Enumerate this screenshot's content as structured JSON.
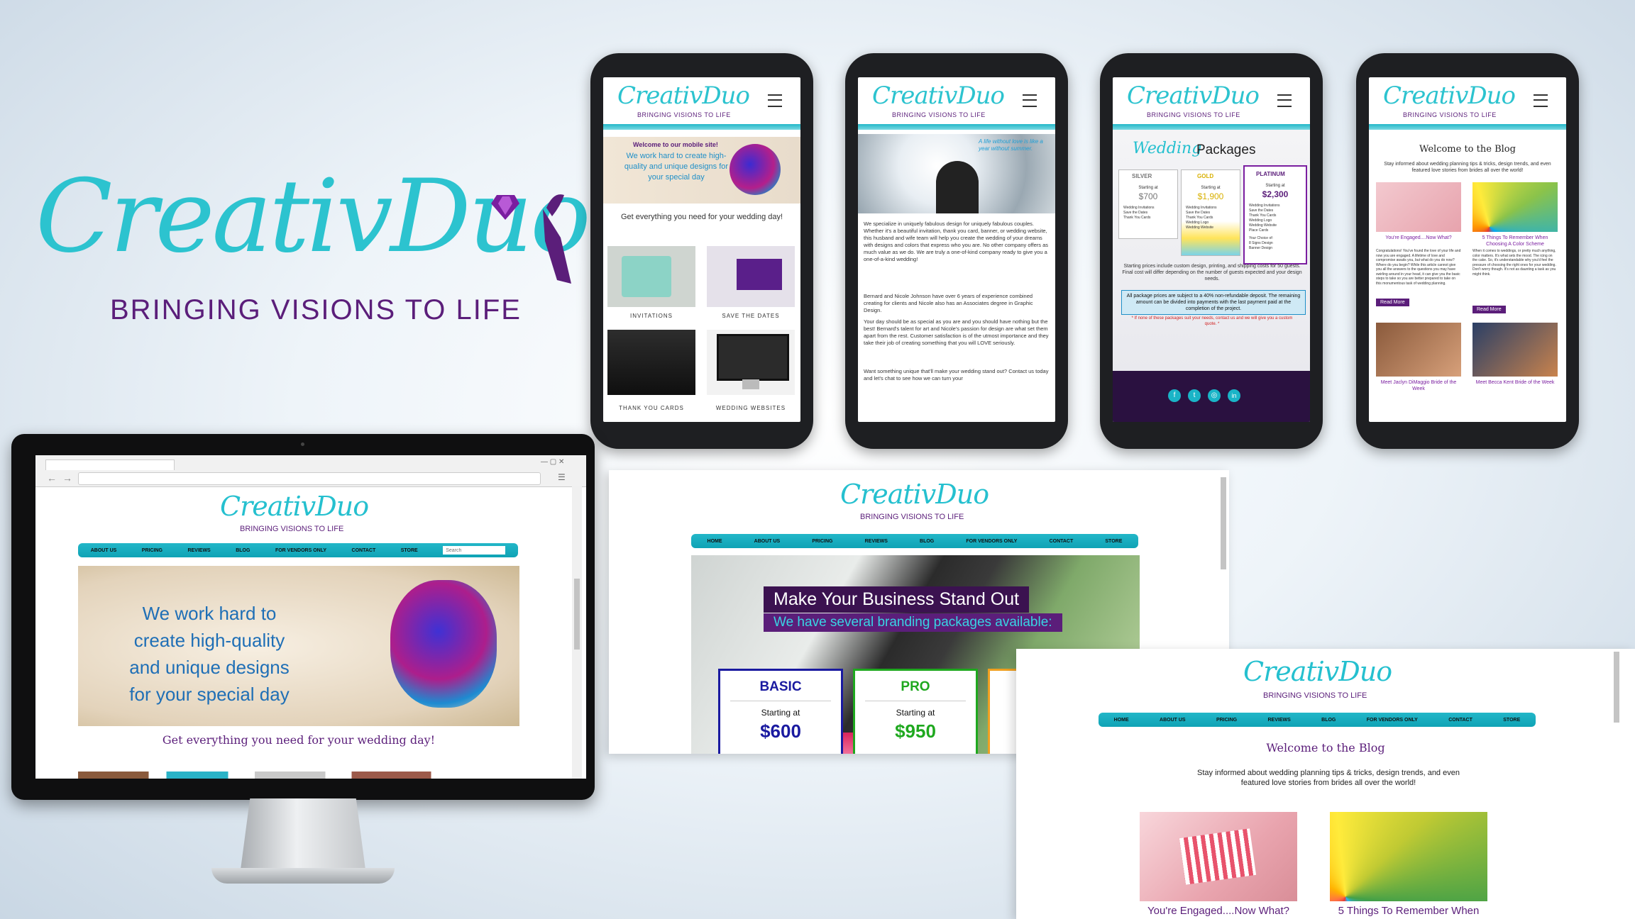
{
  "brand": {
    "name": "CreativDuo",
    "tagline": "BRINGING VISIONS TO LIFE",
    "colors": {
      "teal": "#2cc3cf",
      "purple": "#5b1e7a",
      "nav": "#18b6c6"
    }
  },
  "phone1": {
    "hero_welcome": "Welcome to our mobile site!",
    "hero_text": "We work hard to create high-quality and unique designs for your special day",
    "section_title": "Get everything you need for your wedding day!",
    "tiles": [
      "INVITATIONS",
      "SAVE THE DATES",
      "THANK YOU CARDS",
      "WEDDING WEBSITES"
    ]
  },
  "phone2": {
    "quote": "A life without love is like a year without summer.",
    "p1": "We specialize in uniquely fabulous design for uniquely fabulous couples. Whether it's a beautiful invitation, thank you card, banner, or wedding website, this husband and wife team will help you create the wedding of your dreams with designs and colors that express who you are. No other company offers as much value as we do. We are truly a one-of-kind company ready to give you a one-of-a-kind wedding!",
    "p2": "Bernard and Nicole Johnson have over 6 years of experience combined creating for clients and Nicole also has an Associates degree in Graphic Design.",
    "p3": "Your day should be as special as you are and you should have nothing but the best! Bernard's talent for art and Nicole's passion for design are what set them apart from the rest. Customer satisfaction is of the utmost importance and they take their job of creating something that you will LOVE seriously.",
    "p4": "Want something unique that'll make your wedding stand out? Contact us today and let's chat to see how we can turn your"
  },
  "phone3": {
    "title_script": "Wedding",
    "title": "Packages",
    "packages": [
      {
        "name": "SILVER",
        "label": "Starting at",
        "price": "$700",
        "items": [
          "Wedding Invitations",
          "Save the Dates",
          "Thank You Cards"
        ]
      },
      {
        "name": "GOLD",
        "label": "Starting at",
        "price": "$1,900",
        "items": [
          "Wedding Invitations",
          "Save the Dates",
          "Thank You Cards",
          "Wedding Logo",
          "Wedding Website"
        ]
      },
      {
        "name": "PLATINUM",
        "label": "Starting at",
        "price": "$2,300",
        "items": [
          "Wedding Invitations",
          "Save the Dates",
          "Thank You Cards",
          "Wedding Logo",
          "Wedding Website",
          "Place Cards",
          "Your Choice of:",
          "8 Signs Design",
          "Banner Design"
        ]
      }
    ],
    "note": "Starting prices include custom design, printing, and shipping costs for 50 guests. Final cost will differ depending on the number of guests expected and your design needs.",
    "deposit": "All package prices are subject to a 40% non-refundable deposit. The remaining amount can be divided into payments with the last payment paid at the completion of the project.",
    "footnote": "* If none of these packages suit your needs, contact us and we will give you a custom quote. *",
    "social": [
      "f",
      "t",
      "◎",
      "in"
    ]
  },
  "phone4": {
    "title": "Welcome to the Blog",
    "intro": "Stay informed about wedding planning tips & tricks, design trends, and even featured love stories from brides all over the world!",
    "posts": [
      {
        "title": "You're Engaged....Now What?",
        "excerpt": "Congratulations! You've found the love of your life and now you are engaged. A lifetime of love and compromise awaits you, but what do you do now? Where do you begin? While this article cannot give you all the answers to the questions you may have swirling around in your head, it can give you the basic steps to take so you are better prepared to take on this monumentous task of wedding planning.",
        "button": "Read More"
      },
      {
        "title": "5 Things To Remember When Choosing A Color Scheme",
        "excerpt": "When it comes to weddings, or pretty much anything, color matters. It's what sets the mood. The icing on the cake. So, it's understandable why you'd feel the pressure of choosing the right ones for your wedding. Don't worry though. It's not as daunting a task as you might think.",
        "button": "Read More"
      },
      {
        "title": "Meet Jaclyn DiMaggio Bride of the Week"
      },
      {
        "title": "Meet Becca Kent Bride of the Week"
      }
    ]
  },
  "desktop": {
    "nav": [
      "ABOUT US",
      "PRICING",
      "REVIEWS",
      "BLOG",
      "FOR VENDORS ONLY",
      "CONTACT",
      "STORE"
    ],
    "search_placeholder": "Search",
    "hero_text": "We work hard to create high-quality and unique designs for your special day",
    "section_title": "Get everything you need for your wedding day!"
  },
  "pricing_page": {
    "nav": [
      "HOME",
      "ABOUT US",
      "PRICING",
      "REVIEWS",
      "BLOG",
      "FOR VENDORS ONLY",
      "CONTACT",
      "STORE"
    ],
    "headline": "Make Your Business Stand Out",
    "subline": "We have several branding packages available:",
    "cards": [
      {
        "name": "BASIC",
        "label": "Starting at",
        "price": "$600",
        "color": "#1a1aa0"
      },
      {
        "name": "PRO",
        "label": "Starting at",
        "price": "$950",
        "color": "#1fa81f"
      }
    ]
  },
  "blog_page": {
    "nav": [
      "HOME",
      "ABOUT US",
      "PRICING",
      "REVIEWS",
      "BLOG",
      "FOR VENDORS ONLY",
      "CONTACT",
      "STORE"
    ],
    "title": "Welcome to the Blog",
    "intro": "Stay informed about wedding planning tips & tricks, design trends, and even featured love stories from brides all over the world!",
    "post1": "You're Engaged....Now What?",
    "post2": "5 Things To Remember When"
  }
}
